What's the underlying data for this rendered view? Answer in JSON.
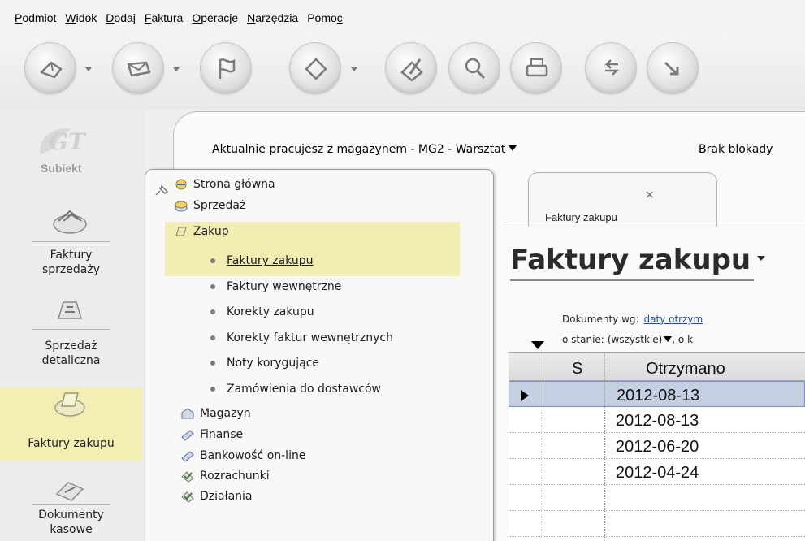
{
  "menu": [
    {
      "u": "P",
      "rest": "odmiot"
    },
    {
      "u": "W",
      "rest": "idok"
    },
    {
      "u": "D",
      "rest": "odaj"
    },
    {
      "u": "F",
      "rest": "aktura"
    },
    {
      "u": "O",
      "rest": "peracje"
    },
    {
      "u": "N",
      "rest": "arzędzia"
    },
    {
      "pre": "Pomo",
      "u": "c",
      "rest": ""
    }
  ],
  "logo": {
    "text": "Subiekt"
  },
  "left_nav": [
    {
      "label_1": "Faktury",
      "label_2": "sprzedaży",
      "icon": "sales-invoices-icon"
    },
    {
      "label_1": "Sprzedaż",
      "label_2": "detaliczna",
      "icon": "cash-register-icon"
    },
    {
      "label_1": "Faktury zakupu",
      "label_2": "",
      "icon": "purchase-invoices-icon"
    },
    {
      "label_1": "Dokumenty",
      "label_2": "kasowe",
      "icon": "cash-documents-icon"
    }
  ],
  "infobar": {
    "warehouse": "Aktualnie pracujesz z magazynem - MG2 - Warsztat",
    "lock": "Brak blokady"
  },
  "tree": {
    "nodes": [
      {
        "label": "Strona główna",
        "icon": "home-icon"
      },
      {
        "label": "Sprzedaż",
        "icon": "sales-icon"
      },
      {
        "label": "Zakup",
        "icon": "purchase-icon"
      }
    ],
    "subitems": [
      "Faktury zakupu",
      "Faktury wewnętrzne",
      "Korekty zakupu",
      "Korekty faktur wewnętrznych",
      "Noty korygujące",
      "Zamówienia do dostawców"
    ],
    "nodes2": [
      {
        "label": "Magazyn",
        "icon": "warehouse-icon"
      },
      {
        "label": "Finanse",
        "icon": "finance-icon"
      },
      {
        "label": "Bankowość on-line",
        "icon": "online-banking-icon"
      },
      {
        "label": "Rozrachunki",
        "icon": "settlements-icon"
      },
      {
        "label": "Działania",
        "icon": "actions-icon"
      }
    ]
  },
  "doc": {
    "tab_label": "Faktury zakupu",
    "tab_close": "×",
    "title": "Faktury zakupu",
    "filter_label": "Dokumenty wg:",
    "filter_value": "daty otrzym",
    "state_label": "o stanie:",
    "state_value": "(wszystkie)",
    "state_rest": ", o k"
  },
  "grid": {
    "columns": [
      "S",
      "Otrzymano"
    ],
    "rows": [
      "2012-08-13",
      "2012-08-13",
      "2012-06-20",
      "2012-04-24",
      ""
    ]
  }
}
